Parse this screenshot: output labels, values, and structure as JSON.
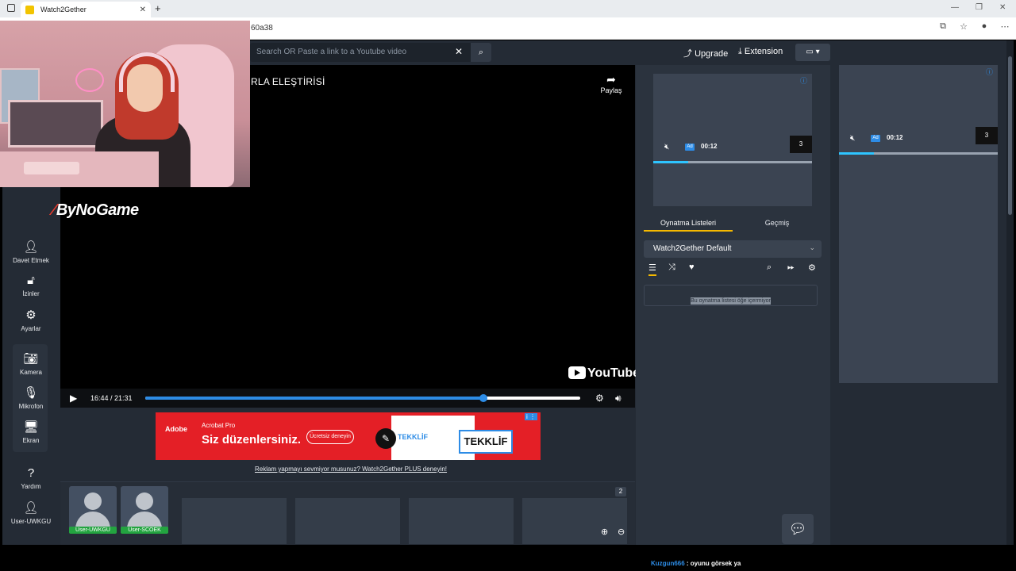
{
  "browser": {
    "tab_title": "Watch2Gether",
    "url_fragment": "60a38",
    "new_tab": "+",
    "tab_close": "✕"
  },
  "header": {
    "search_placeholder": "Search OR Paste a link to a Youtube video",
    "upgrade_label": "Upgrade",
    "extension_label": "Extension"
  },
  "overlay": {
    "brand": "ByNoGame"
  },
  "video": {
    "title": "RLA ELEŞTİRİSİ",
    "share_label": "Paylaş",
    "provider": "YouTube",
    "time": "16:44 / 21:31",
    "progress": 0.778
  },
  "left_rail": [
    {
      "icon": "add-user-icon",
      "label": "Davet Etmek"
    },
    {
      "icon": "unlock-icon",
      "label": "İzinler"
    },
    {
      "icon": "gear-icon",
      "label": "Ayarlar"
    },
    {
      "icon": "camera-icon",
      "label": "Kamera"
    },
    {
      "icon": "microphone-icon",
      "label": "Mikrofon"
    },
    {
      "icon": "monitor-icon",
      "label": "Ekran"
    },
    {
      "icon": "help-icon",
      "label": "Yardım"
    },
    {
      "icon": "user-icon",
      "label": "User-UWKGU"
    }
  ],
  "ad": {
    "brand": "Adobe",
    "product": "Acrobat Pro",
    "headline": "Siz düzenlersiniz.",
    "cta": "Ücretsiz deneyin",
    "panel_text": "TEKKLİF",
    "callout": "TEKKLİF",
    "plus_link": "Reklam yapmayı sevmiyor musunuz? Watch2Gether PLUS deneyin!"
  },
  "users": [
    {
      "name": "User-UWKGU"
    },
    {
      "name": "User-SCOEK"
    }
  ],
  "user_count": "2",
  "mini_player": {
    "time": "00:12",
    "number": "3",
    "ad_badge": "Ad",
    "progress": 0.22
  },
  "playlist": {
    "tab_playlists": "Oynatma Listeleri",
    "tab_history": "Geçmiş",
    "selected": "Watch2Gether Default",
    "empty_text": "Bu oynatma listesi öğe içermiyor"
  },
  "chat": {
    "user": "Kuzgun666",
    "message": " : oyunu görsek ya"
  },
  "colors": {
    "accent_blue": "#2d8ce6",
    "tab_underline": "#f5b900",
    "user_badge": "#23a440",
    "bg": "#242b35"
  }
}
